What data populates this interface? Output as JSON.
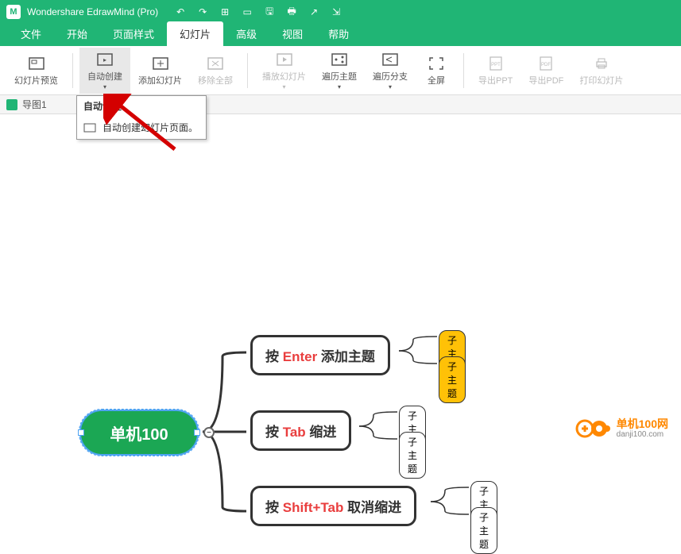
{
  "titlebar": {
    "title": "Wondershare EdrawMind (Pro)",
    "logo": "M"
  },
  "menu": {
    "items": [
      "文件",
      "开始",
      "页面样式",
      "幻灯片",
      "高级",
      "视图",
      "帮助"
    ],
    "activeIndex": 3
  },
  "ribbon": {
    "preview": "幻灯片预览",
    "autoCreate": "自动创建",
    "addSlide": "添加幻灯片",
    "removeAll": "移除全部",
    "playSlide": "播放幻灯片",
    "traverseTopic": "遍历主题",
    "traverseBranch": "遍历分支",
    "fullscreen": "全屏",
    "exportPPT": "导出PPT",
    "exportPDF": "导出PDF",
    "printSlide": "打印幻灯片"
  },
  "tab": {
    "label": "导图1"
  },
  "dropdown": {
    "header": "自动创建",
    "item1": "自动创建幻灯片页面。"
  },
  "mindmap": {
    "root": "单机100",
    "branch1_pre": "按 ",
    "branch1_kw": "Enter",
    "branch1_post": " 添加主题",
    "branch2_pre": "按 ",
    "branch2_kw": "Tab",
    "branch2_post": " 缩进",
    "branch3_pre": "按 ",
    "branch3_kw": "Shift+Tab",
    "branch3_post": " 取消缩进",
    "sub": "子主题"
  },
  "watermark": {
    "text": "单机100网",
    "sub": "danji100.com"
  }
}
